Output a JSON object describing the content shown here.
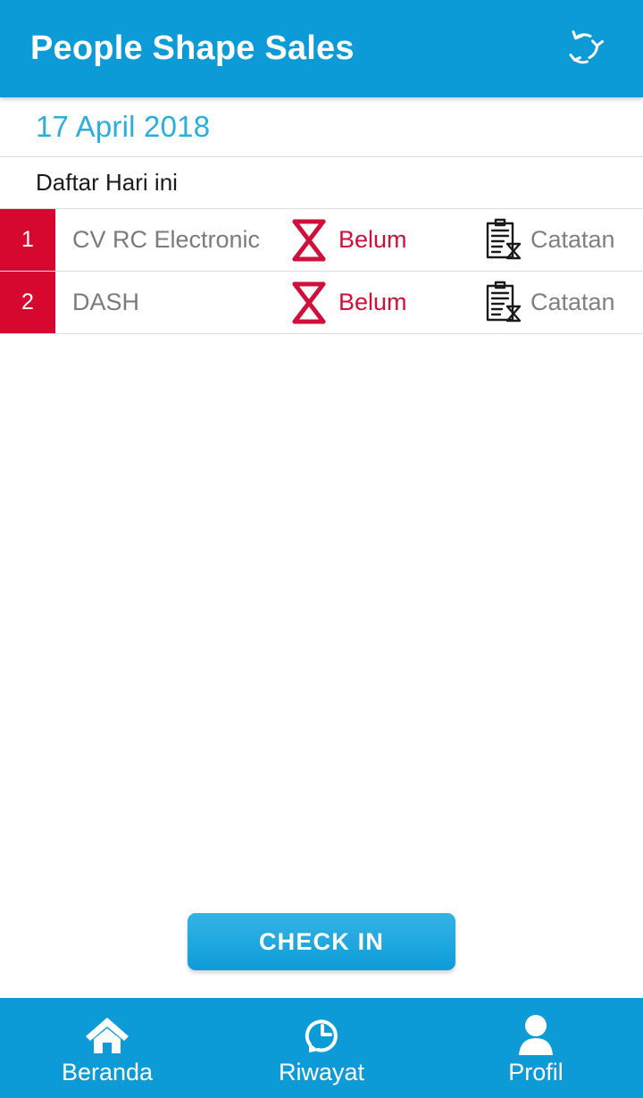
{
  "appbar": {
    "title": "People Shape Sales",
    "sync_icon": "sync-recycle-icon"
  },
  "date_header": {
    "date": "17 April 2018"
  },
  "section": {
    "title": "Daftar Hari ini"
  },
  "list": {
    "rows": [
      {
        "index": "1",
        "name": "CV RC Electronic",
        "status_label": "Belum",
        "status_icon": "hourglass-icon",
        "note_label": "Catatan",
        "note_icon": "clipboard-hourglass-icon"
      },
      {
        "index": "2",
        "name": "DASH",
        "status_label": "Belum",
        "status_icon": "hourglass-icon",
        "note_label": "Catatan",
        "note_icon": "clipboard-hourglass-icon"
      }
    ]
  },
  "actions": {
    "checkin_label": "CHECK IN"
  },
  "bottomnav": {
    "items": [
      {
        "label": "Beranda",
        "icon": "home-icon"
      },
      {
        "label": "Riwayat",
        "icon": "history-clock-icon"
      },
      {
        "label": "Profil",
        "icon": "person-icon"
      }
    ]
  },
  "colors": {
    "brand_blue": "#0C9BD6",
    "date_blue": "#29AEE0",
    "accent_red": "#D6082F",
    "status_red": "#D0103A",
    "muted_gray": "#7b7b7b",
    "note_gray": "#808080",
    "button_blue": "#22A9DF"
  }
}
